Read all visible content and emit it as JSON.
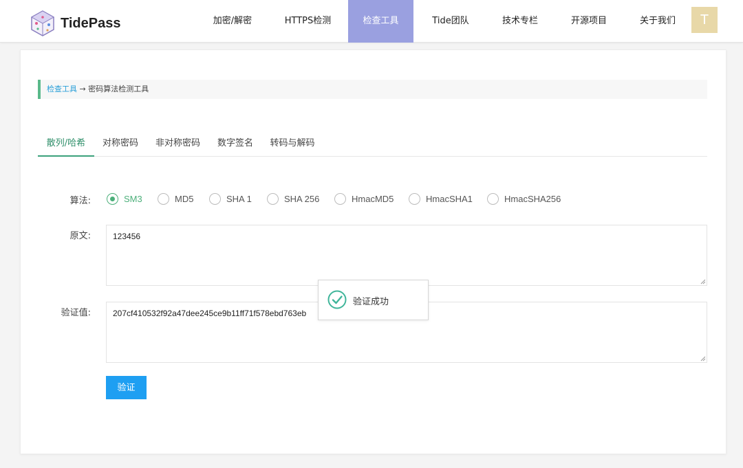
{
  "header": {
    "brand": "TidePass",
    "nav": [
      {
        "label": "加密/解密",
        "active": false
      },
      {
        "label": "HTTPS检测",
        "active": false
      },
      {
        "label": "检查工具",
        "active": true
      },
      {
        "label": "Tide团队",
        "active": false
      },
      {
        "label": "技术专栏",
        "active": false
      },
      {
        "label": "开源项目",
        "active": false
      },
      {
        "label": "关于我们",
        "active": false
      }
    ],
    "avatar_letter": "T"
  },
  "breadcrumb": {
    "link": "检查工具",
    "separator": " → ",
    "current": "密码算法检测工具"
  },
  "tabs": [
    {
      "label": "散列/哈希",
      "active": true
    },
    {
      "label": "对称密码",
      "active": false
    },
    {
      "label": "非对称密码",
      "active": false
    },
    {
      "label": "数字签名",
      "active": false
    },
    {
      "label": "转码与解码",
      "active": false
    }
  ],
  "form": {
    "algorithm_label": "算法:",
    "algorithms": [
      {
        "label": "SM3",
        "checked": true
      },
      {
        "label": "MD5",
        "checked": false
      },
      {
        "label": "SHA 1",
        "checked": false
      },
      {
        "label": "SHA 256",
        "checked": false
      },
      {
        "label": "HmacMD5",
        "checked": false
      },
      {
        "label": "HmacSHA1",
        "checked": false
      },
      {
        "label": "HmacSHA256",
        "checked": false
      }
    ],
    "plaintext_label": "原文:",
    "plaintext_value": "123456",
    "verify_label": "验证值:",
    "verify_value": "207cf410532f92a47dee245ce9b11ff71f578ebd763eb",
    "verify_button": "验证"
  },
  "toast": {
    "message": "验证成功"
  },
  "colors": {
    "nav_active_bg": "#9aa0e0",
    "accent_green": "#4caf7a",
    "button_blue": "#1e9ff2",
    "link_blue": "#2a9fd8",
    "avatar_bg": "#e8d8a8"
  }
}
